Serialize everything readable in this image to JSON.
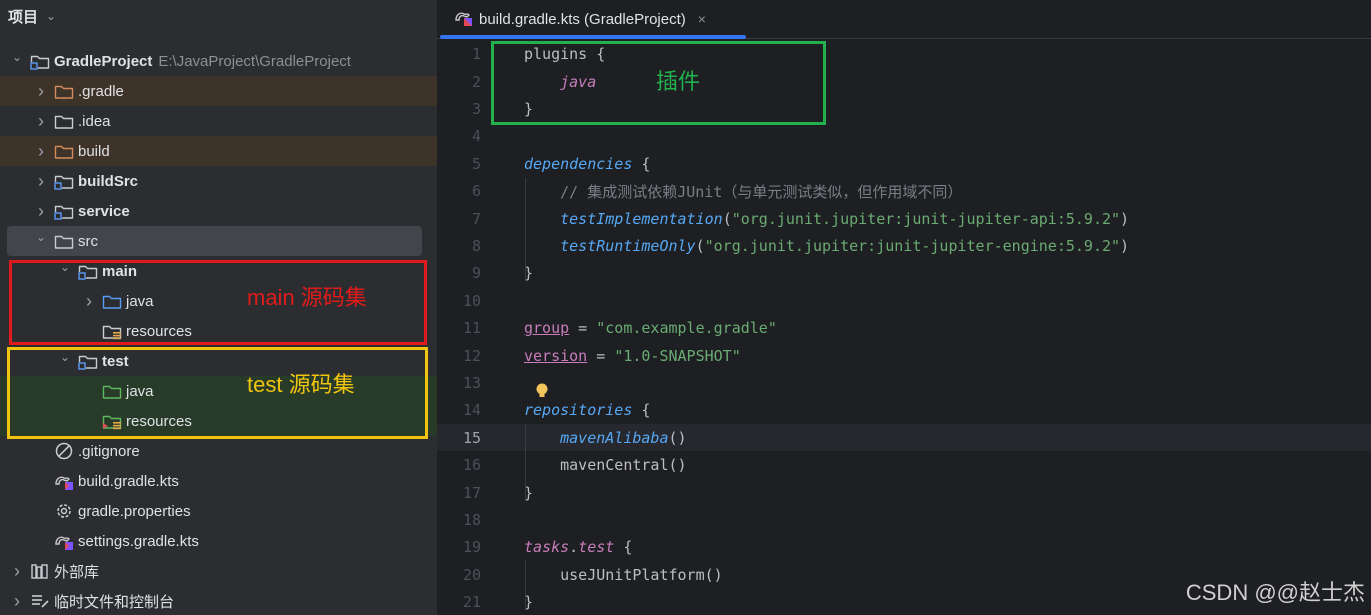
{
  "project_panel": {
    "title": "项目",
    "tree": [
      {
        "name": "project-root",
        "label": "GradleProject",
        "path": "E:\\JavaProject\\GradleProject",
        "bold": true,
        "expanded": true,
        "depth": 0,
        "icon": "module-folder-icon"
      },
      {
        "name": "folder-gradle",
        "label": ".gradle",
        "depth": 1,
        "icon": "excluded-folder-icon",
        "excluded": true
      },
      {
        "name": "folder-idea",
        "label": ".idea",
        "depth": 1,
        "icon": "folder-icon"
      },
      {
        "name": "folder-build",
        "label": "build",
        "depth": 1,
        "icon": "excluded-folder-icon",
        "excluded": true
      },
      {
        "name": "module-buildsrc",
        "label": "buildSrc",
        "bold": true,
        "depth": 1,
        "icon": "module-folder-icon"
      },
      {
        "name": "module-service",
        "label": "service",
        "bold": true,
        "depth": 1,
        "icon": "module-folder-icon"
      },
      {
        "name": "folder-src",
        "label": "src",
        "depth": 1,
        "icon": "folder-icon",
        "expanded": true,
        "selected": true
      },
      {
        "name": "folder-main",
        "label": "main",
        "bold": true,
        "depth": 2,
        "icon": "module-folder-icon",
        "expanded": true
      },
      {
        "name": "folder-main-java",
        "label": "java",
        "depth": 3,
        "icon": "source-folder-icon"
      },
      {
        "name": "folder-main-resources",
        "label": "resources",
        "depth": 3,
        "icon": "resources-folder-icon",
        "no_arrow": true
      },
      {
        "name": "folder-test",
        "label": "test",
        "bold": true,
        "depth": 2,
        "icon": "module-folder-icon",
        "expanded": true
      },
      {
        "name": "folder-test-java",
        "label": "java",
        "depth": 3,
        "icon": "test-source-folder-icon",
        "no_arrow": true,
        "test": true
      },
      {
        "name": "folder-test-resources",
        "label": "resources",
        "depth": 3,
        "icon": "test-resources-folder-icon",
        "no_arrow": true,
        "test": true
      },
      {
        "name": "file-gitignore",
        "label": ".gitignore",
        "depth": 1,
        "icon": "ignored-file-icon",
        "no_arrow": true
      },
      {
        "name": "file-build-gradle-kts",
        "label": "build.gradle.kts",
        "depth": 1,
        "icon": "gradle-kts-icon",
        "no_arrow": true
      },
      {
        "name": "file-gradle-properties",
        "label": "gradle.properties",
        "depth": 1,
        "icon": "gear-icon",
        "no_arrow": true
      },
      {
        "name": "file-settings-gradle-kts",
        "label": "settings.gradle.kts",
        "depth": 1,
        "icon": "gradle-kts-icon",
        "no_arrow": true
      },
      {
        "name": "external-libraries",
        "label": "外部库",
        "depth": 0,
        "icon": "library-icon"
      },
      {
        "name": "scratches-consoles",
        "label": "临时文件和控制台",
        "depth": 0,
        "icon": "scratches-icon"
      }
    ],
    "annotations": {
      "main": {
        "text": "main 源码集",
        "color": "#e11b1b"
      },
      "test": {
        "text": "test 源码集",
        "color": "#f1c40f"
      }
    }
  },
  "editor": {
    "tab": {
      "label": "build.gradle.kts (GradleProject)",
      "close": "×",
      "icon": "gradle-kts-icon"
    },
    "current_line": 15,
    "annotation": {
      "text": "插件",
      "color": "#22b14c"
    },
    "lines": [
      [
        {
          "t": "plugins {",
          "c": ""
        }
      ],
      [
        {
          "t": "    ",
          "c": ""
        },
        {
          "t": "java",
          "c": "kw-java"
        }
      ],
      [
        {
          "t": "}",
          "c": ""
        }
      ],
      [],
      [
        {
          "t": "dependencies",
          "c": "kw-fn"
        },
        {
          "t": " {",
          "c": ""
        }
      ],
      [
        {
          "t": "    // 集成测试依赖JUnit（与单元测试类似，但作用域不同）",
          "c": "cmt"
        }
      ],
      [
        {
          "t": "    ",
          "c": ""
        },
        {
          "t": "testImplementation",
          "c": "kw-fn"
        },
        {
          "t": "(",
          "c": ""
        },
        {
          "t": "\"org.junit.jupiter:junit-jupiter-api:5.9.2\"",
          "c": "str"
        },
        {
          "t": ")",
          "c": ""
        }
      ],
      [
        {
          "t": "    ",
          "c": ""
        },
        {
          "t": "testRuntimeOnly",
          "c": "kw-fn"
        },
        {
          "t": "(",
          "c": ""
        },
        {
          "t": "\"org.junit.jupiter:junit-jupiter-engine:5.9.2\"",
          "c": "str"
        },
        {
          "t": ")",
          "c": ""
        }
      ],
      [
        {
          "t": "}",
          "c": ""
        }
      ],
      [],
      [
        {
          "t": "group",
          "c": "prop"
        },
        {
          "t": " = ",
          "c": ""
        },
        {
          "t": "\"com.example.gradle\"",
          "c": "str"
        }
      ],
      [
        {
          "t": "version",
          "c": "prop"
        },
        {
          "t": " = ",
          "c": ""
        },
        {
          "t": "\"1.0-SNAPSHOT\"",
          "c": "str"
        }
      ],
      [],
      [
        {
          "t": "repositories",
          "c": "kw-fn"
        },
        {
          "t": " {",
          "c": ""
        }
      ],
      [
        {
          "t": "    ",
          "c": ""
        },
        {
          "t": "mavenAlibaba",
          "c": "kw-fn"
        },
        {
          "t": "()",
          "c": ""
        }
      ],
      [
        {
          "t": "    mavenCentral()",
          "c": ""
        }
      ],
      [
        {
          "t": "}",
          "c": ""
        }
      ],
      [],
      [
        {
          "t": "tasks",
          "c": "kw-java"
        },
        {
          "t": ".",
          "c": ""
        },
        {
          "t": "test",
          "c": "kw-java"
        },
        {
          "t": " {",
          "c": ""
        }
      ],
      [
        {
          "t": "    useJUnitPlatform()",
          "c": ""
        }
      ],
      [
        {
          "t": "}",
          "c": ""
        }
      ]
    ]
  },
  "watermark": "CSDN @@赵士杰"
}
